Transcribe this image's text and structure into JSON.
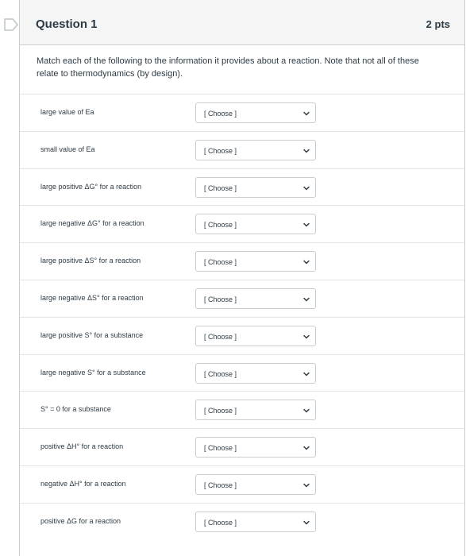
{
  "question": {
    "title": "Question 1",
    "points": "2 pts",
    "prompt": "Match each of the following to the information it provides about a reaction. Note that not all of these relate to thermodynamics (by design)."
  },
  "rows": [
    {
      "label": "large value of Ea",
      "choice": "[ Choose ]"
    },
    {
      "label": "small value of Ea",
      "choice": "[ Choose ]"
    },
    {
      "label": "large positive ΔG° for a reaction",
      "choice": "[ Choose ]"
    },
    {
      "label": "large negative ΔG° for a reaction",
      "choice": "[ Choose ]"
    },
    {
      "label": "large positive ΔS° for a reaction",
      "choice": "[ Choose ]"
    },
    {
      "label": "large negative ΔS° for a reaction",
      "choice": "[ Choose ]"
    },
    {
      "label": "large positive S° for a substance",
      "choice": "[ Choose ]"
    },
    {
      "label": "large negative S° for a substance",
      "choice": "[ Choose ]"
    },
    {
      "label": "S° = 0 for a substance",
      "choice": "[ Choose ]"
    },
    {
      "label": "positive ΔH° for a reaction",
      "choice": "[ Choose ]"
    },
    {
      "label": "negative ΔH° for a reaction",
      "choice": "[ Choose ]"
    },
    {
      "label": "positive ΔG for a reaction",
      "choice": "[ Choose ]"
    }
  ],
  "icons": {
    "flag": "flag-icon",
    "dropdown": "chevron-down-icon"
  },
  "colors": {
    "header_bg": "#f5f5f5",
    "border": "#c7cdd1",
    "text": "#2d3b45"
  }
}
